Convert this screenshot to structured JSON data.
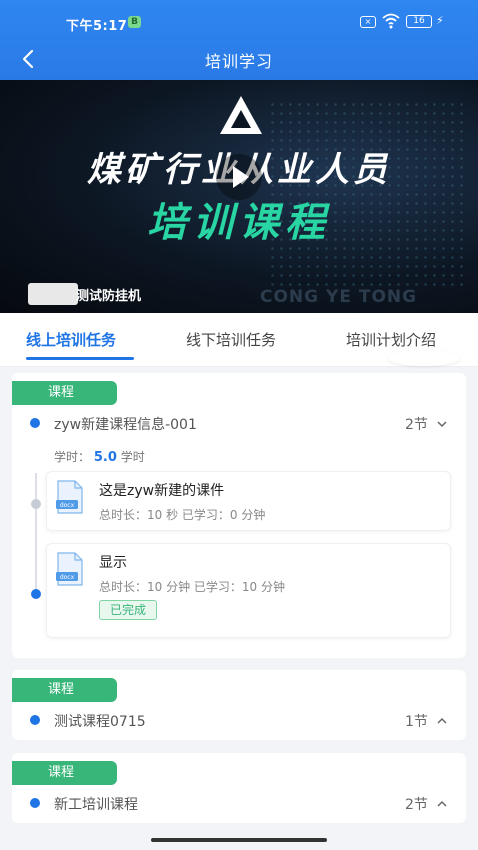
{
  "status": {
    "time": "下午5:17",
    "notification_badge": "B",
    "sim_label": "×",
    "battery": "16",
    "charging": "⚡"
  },
  "header": {
    "title": "培训学习",
    "back_icon": "chevron-left-icon"
  },
  "banner": {
    "line1": "煤矿行业从业人员",
    "line2": "培训课程",
    "watermark": "CONG YE TONG",
    "caption": "测试防挂机",
    "play_icon": "play-icon",
    "colors": {
      "line2": "#28d5a3",
      "background": "#0c1622"
    }
  },
  "tabs": [
    {
      "label": "线上培训任务",
      "active": true
    },
    {
      "label": "线下培训任务",
      "active": false
    },
    {
      "label": "培训计划介绍",
      "active": false
    }
  ],
  "courses": [
    {
      "tag": "课程",
      "title": "zyw新建课程信息-001",
      "lessons": "2节",
      "expanded": true,
      "hours_label": "学时：",
      "hours_value": "5.0",
      "hours_unit": "学时",
      "items": [
        {
          "title": "这是zyw新建的课件",
          "meta": "总时长：10 秒   已学习：0 分钟",
          "icon": "docx-file-icon",
          "done": ""
        },
        {
          "title": "显示",
          "meta": "总时长：10 分钟   已学习：10 分钟",
          "icon": "docx-file-icon",
          "done": "已完成"
        }
      ]
    },
    {
      "tag": "课程",
      "title": "测试课程0715",
      "lessons": "1节",
      "expanded": false
    },
    {
      "tag": "课程",
      "title": "新工培训课程",
      "lessons": "2节",
      "expanded": false
    }
  ],
  "colors": {
    "primary": "#1f74e6",
    "tag_green": "#38b579",
    "header_blue": "#2f86f0"
  }
}
